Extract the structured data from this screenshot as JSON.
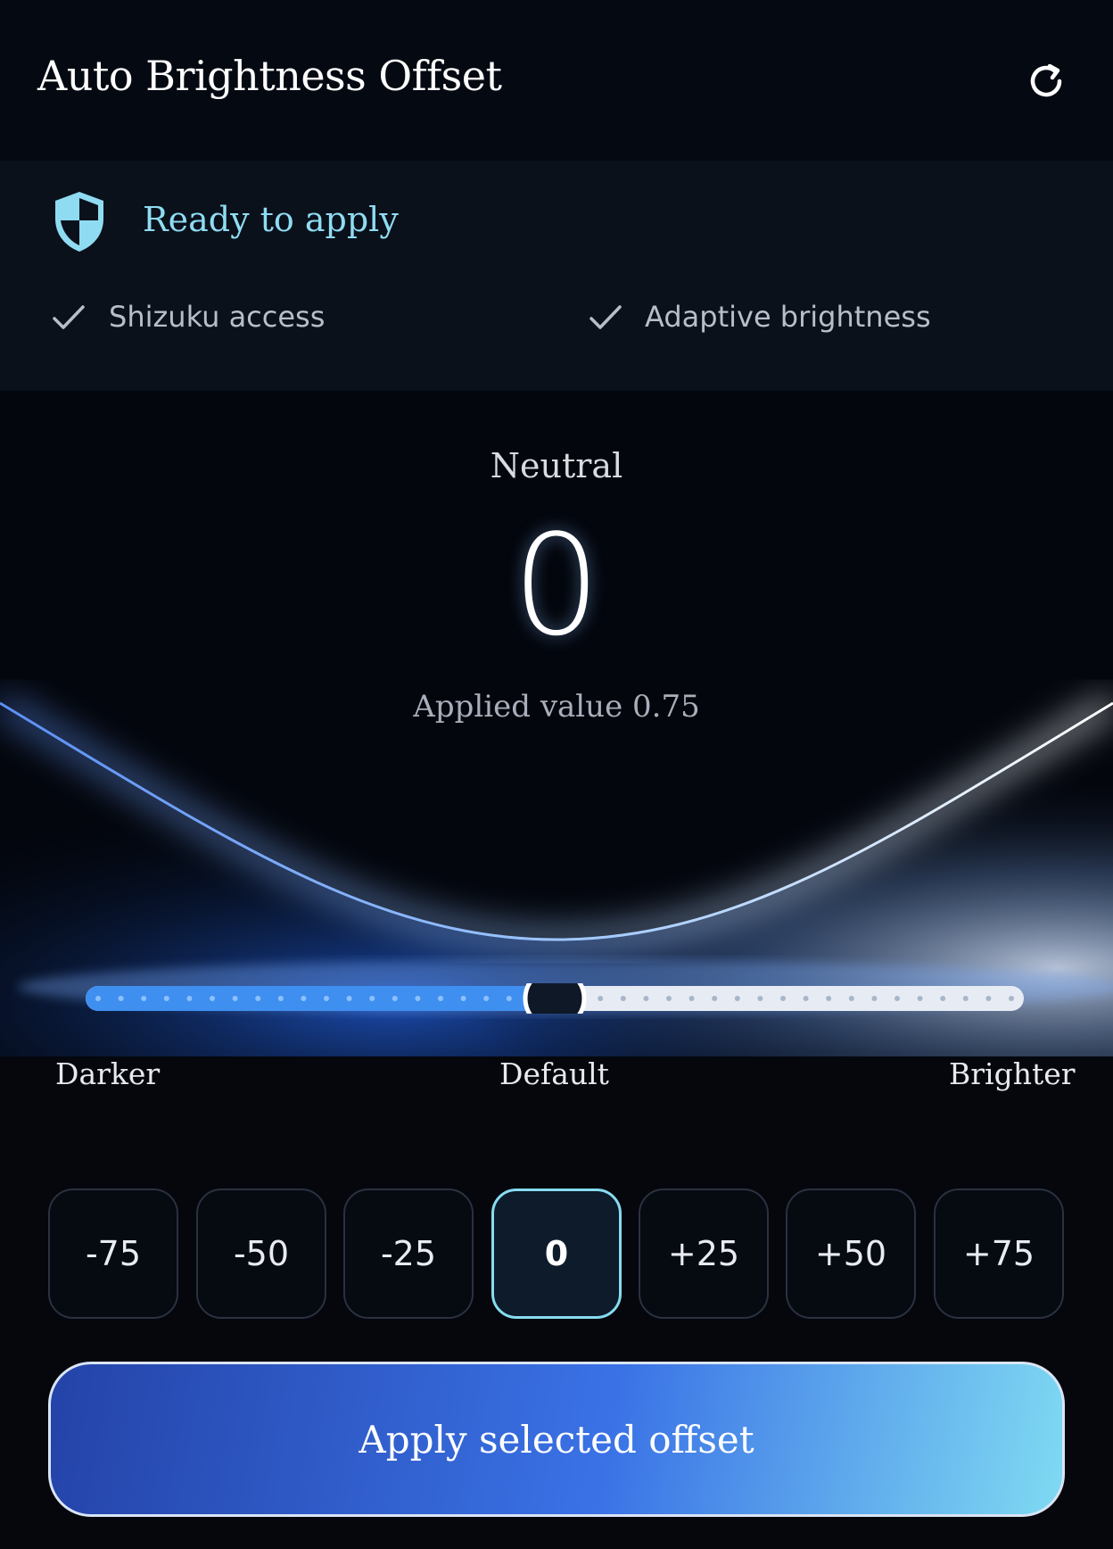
{
  "header": {
    "title": "Auto Brightness Offset",
    "refresh_icon": "refresh-icon"
  },
  "status": {
    "icon": "shield-icon",
    "text": "Ready to apply",
    "requirements": [
      {
        "label": "Shizuku access",
        "icon": "check-icon"
      },
      {
        "label": "Adaptive brightness",
        "icon": "check-icon"
      }
    ]
  },
  "offset": {
    "mode_label": "Neutral",
    "value": "0",
    "applied_text": "Applied value 0.75",
    "slider": {
      "min": -75,
      "max": 75,
      "current": 0
    },
    "labels": {
      "left": "Darker",
      "center": "Default",
      "right": "Brighter"
    }
  },
  "presets": [
    {
      "label": "-75",
      "selected": false
    },
    {
      "label": "-50",
      "selected": false
    },
    {
      "label": "-25",
      "selected": false
    },
    {
      "label": "0",
      "selected": true
    },
    {
      "label": "+25",
      "selected": false
    },
    {
      "label": "+50",
      "selected": false
    },
    {
      "label": "+75",
      "selected": false
    }
  ],
  "apply_button": {
    "label": "Apply selected offset"
  },
  "colors": {
    "accent": "#8fdcf2",
    "slider_fill": "#3f8ff0",
    "background": "#05070d"
  }
}
